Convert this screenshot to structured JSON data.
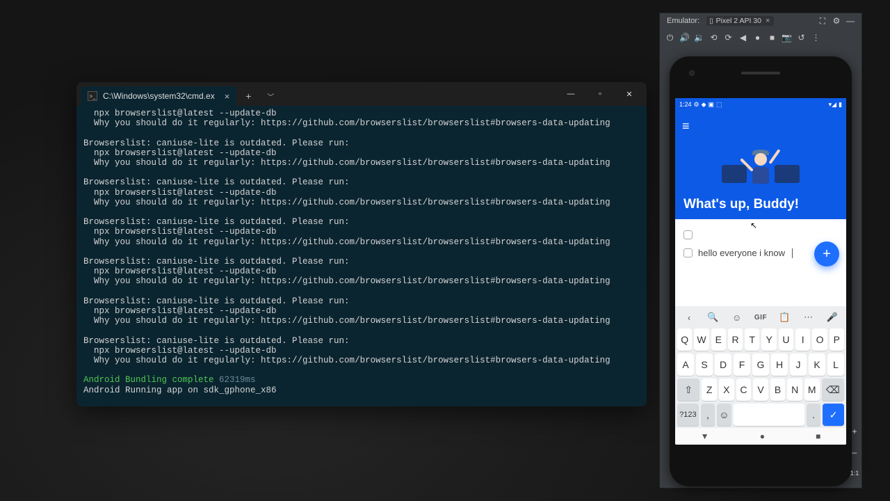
{
  "terminal": {
    "tab_title": "C:\\Windows\\system32\\cmd.ex",
    "lines": {
      "cmd": "  npx browserslist@latest --update-db",
      "why": "  Why you should do it regularly: https://github.com/browserslist/browserslist#browsers-data-updating",
      "head": "Browserslist: caniuse-lite is outdated. Please run:",
      "bundle_a": "Android Bundling complete",
      "bundle_b": " 62319ms",
      "running": "Android Running app on sdk_gphone_x86"
    },
    "repeat_count": 7
  },
  "emulator": {
    "title": "Emulator:",
    "device": "Pixel 2 API 30",
    "status": {
      "time": "1:24",
      "left_icons": [
        "⚙",
        "◆",
        "▣",
        "⬚"
      ],
      "right_icons": [
        "▾◢",
        "▮"
      ]
    },
    "app": {
      "greeting": "What's up, Buddy!",
      "tasks": [
        "",
        "hello everyone i know"
      ],
      "fab": "+"
    },
    "keyboard": {
      "suggestion_icons": [
        "‹",
        "🔍",
        "☺",
        "GIF",
        "📋",
        "⋯",
        "🎤"
      ],
      "row1": [
        "Q",
        "W",
        "E",
        "R",
        "T",
        "Y",
        "U",
        "I",
        "O",
        "P"
      ],
      "row2": [
        "A",
        "S",
        "D",
        "F",
        "G",
        "H",
        "J",
        "K",
        "L"
      ],
      "row3": [
        "⇧",
        "Z",
        "X",
        "C",
        "V",
        "B",
        "N",
        "M",
        "⌫"
      ],
      "row4": [
        "?123",
        ",",
        "☺",
        "space",
        ".",
        "✓"
      ]
    },
    "nav_keys": [
      "▼",
      "●",
      "■"
    ],
    "side_buttons": [
      "+",
      "–",
      "1:1"
    ]
  }
}
